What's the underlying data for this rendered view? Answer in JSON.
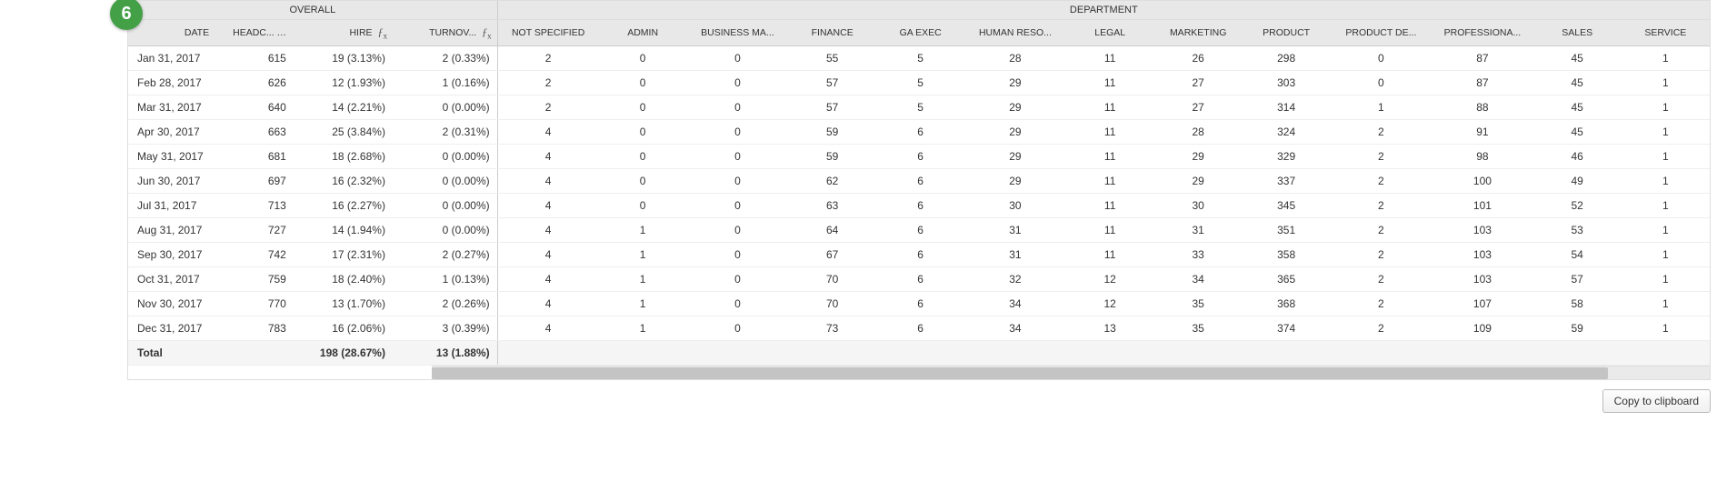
{
  "badge": "6",
  "groups": {
    "overall": "OVERALL",
    "department": "DEPARTMENT"
  },
  "columns": {
    "date": "DATE",
    "headcount": "HEADC...",
    "hire": "HIRE",
    "turnover": "TURNOV...",
    "dept": [
      "NOT SPECIFIED",
      "ADMIN",
      "BUSINESS MA...",
      "FINANCE",
      "GA EXEC",
      "HUMAN RESO...",
      "LEGAL",
      "MARKETING",
      "PRODUCT",
      "PRODUCT DE...",
      "PROFESSIONA...",
      "SALES",
      "SERVICE"
    ]
  },
  "rows": [
    {
      "date": "Jan 31, 2017",
      "hc": "615",
      "hire": "19 (3.13%)",
      "to": "2 (0.33%)",
      "d": [
        "2",
        "0",
        "0",
        "55",
        "5",
        "28",
        "11",
        "26",
        "298",
        "0",
        "87",
        "45",
        "1"
      ]
    },
    {
      "date": "Feb 28, 2017",
      "hc": "626",
      "hire": "12 (1.93%)",
      "to": "1 (0.16%)",
      "d": [
        "2",
        "0",
        "0",
        "57",
        "5",
        "29",
        "11",
        "27",
        "303",
        "0",
        "87",
        "45",
        "1"
      ]
    },
    {
      "date": "Mar 31, 2017",
      "hc": "640",
      "hire": "14 (2.21%)",
      "to": "0 (0.00%)",
      "d": [
        "2",
        "0",
        "0",
        "57",
        "5",
        "29",
        "11",
        "27",
        "314",
        "1",
        "88",
        "45",
        "1"
      ]
    },
    {
      "date": "Apr 30, 2017",
      "hc": "663",
      "hire": "25 (3.84%)",
      "to": "2 (0.31%)",
      "d": [
        "4",
        "0",
        "0",
        "59",
        "6",
        "29",
        "11",
        "28",
        "324",
        "2",
        "91",
        "45",
        "1"
      ]
    },
    {
      "date": "May 31, 2017",
      "hc": "681",
      "hire": "18 (2.68%)",
      "to": "0 (0.00%)",
      "d": [
        "4",
        "0",
        "0",
        "59",
        "6",
        "29",
        "11",
        "29",
        "329",
        "2",
        "98",
        "46",
        "1"
      ]
    },
    {
      "date": "Jun 30, 2017",
      "hc": "697",
      "hire": "16 (2.32%)",
      "to": "0 (0.00%)",
      "d": [
        "4",
        "0",
        "0",
        "62",
        "6",
        "29",
        "11",
        "29",
        "337",
        "2",
        "100",
        "49",
        "1"
      ]
    },
    {
      "date": "Jul 31, 2017",
      "hc": "713",
      "hire": "16 (2.27%)",
      "to": "0 (0.00%)",
      "d": [
        "4",
        "0",
        "0",
        "63",
        "6",
        "30",
        "11",
        "30",
        "345",
        "2",
        "101",
        "52",
        "1"
      ]
    },
    {
      "date": "Aug 31, 2017",
      "hc": "727",
      "hire": "14 (1.94%)",
      "to": "0 (0.00%)",
      "d": [
        "4",
        "1",
        "0",
        "64",
        "6",
        "31",
        "11",
        "31",
        "351",
        "2",
        "103",
        "53",
        "1"
      ]
    },
    {
      "date": "Sep 30, 2017",
      "hc": "742",
      "hire": "17 (2.31%)",
      "to": "2 (0.27%)",
      "d": [
        "4",
        "1",
        "0",
        "67",
        "6",
        "31",
        "11",
        "33",
        "358",
        "2",
        "103",
        "54",
        "1"
      ]
    },
    {
      "date": "Oct 31, 2017",
      "hc": "759",
      "hire": "18 (2.40%)",
      "to": "1 (0.13%)",
      "d": [
        "4",
        "1",
        "0",
        "70",
        "6",
        "32",
        "12",
        "34",
        "365",
        "2",
        "103",
        "57",
        "1"
      ]
    },
    {
      "date": "Nov 30, 2017",
      "hc": "770",
      "hire": "13 (1.70%)",
      "to": "2 (0.26%)",
      "d": [
        "4",
        "1",
        "0",
        "70",
        "6",
        "34",
        "12",
        "35",
        "368",
        "2",
        "107",
        "58",
        "1"
      ]
    },
    {
      "date": "Dec 31, 2017",
      "hc": "783",
      "hire": "16 (2.06%)",
      "to": "3 (0.39%)",
      "d": [
        "4",
        "1",
        "0",
        "73",
        "6",
        "34",
        "13",
        "35",
        "374",
        "2",
        "109",
        "59",
        "1"
      ]
    }
  ],
  "total": {
    "label": "Total",
    "hire": "198 (28.67%)",
    "to": "13 (1.88%)"
  },
  "footer": {
    "copy": "Copy to clipboard"
  }
}
